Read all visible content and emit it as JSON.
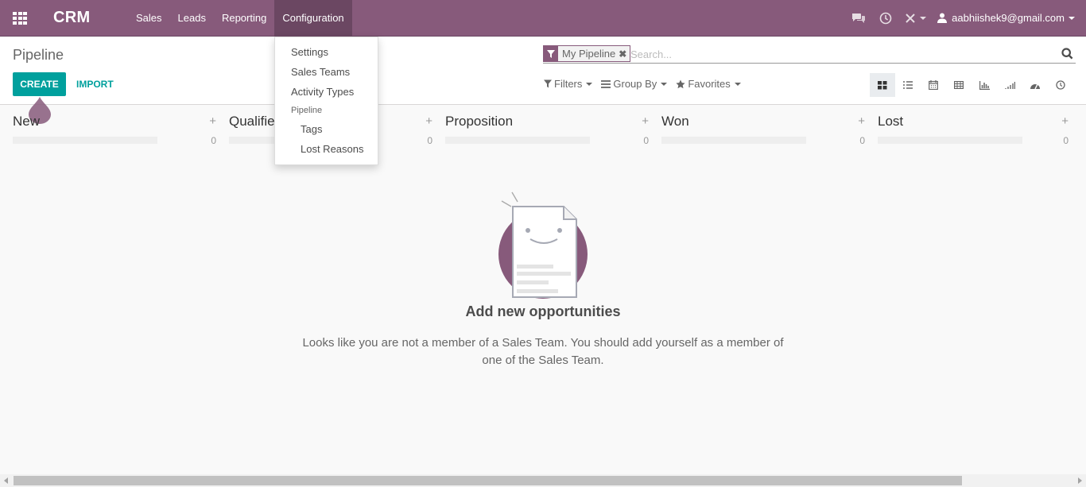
{
  "topbar": {
    "brand": "CRM",
    "menu": [
      "Sales",
      "Leads",
      "Reporting",
      "Configuration"
    ],
    "active_menu": "Configuration",
    "user": "aabhiishek9@gmail.com",
    "icons": [
      "apps-grid-icon",
      "chat-icon",
      "clock-icon",
      "debug-tools-icon",
      "user-icon"
    ]
  },
  "control_panel": {
    "breadcrumb": "Pipeline",
    "create_label": "CREATE",
    "import_label": "IMPORT",
    "search": {
      "facet": "My Pipeline",
      "placeholder": "Search..."
    },
    "filters_label": "Filters",
    "group_by_label": "Group By",
    "favorites_label": "Favorites",
    "views": [
      "kanban",
      "list",
      "calendar",
      "pivot",
      "graph",
      "cohort",
      "dashboard",
      "activity"
    ],
    "active_view": "kanban"
  },
  "kanban": {
    "columns": [
      {
        "title": "New",
        "count": "0"
      },
      {
        "title": "Qualified",
        "count": "0"
      },
      {
        "title": "Proposition",
        "count": "0"
      },
      {
        "title": "Won",
        "count": "0"
      },
      {
        "title": "Lost",
        "count": "0"
      }
    ]
  },
  "dropdown": {
    "items": [
      {
        "label": "Settings",
        "kind": "item"
      },
      {
        "label": "Sales Teams",
        "kind": "item"
      },
      {
        "label": "Activity Types",
        "kind": "item"
      },
      {
        "label": "Pipeline",
        "kind": "header"
      },
      {
        "label": "Tags",
        "kind": "sub"
      },
      {
        "label": "Lost Reasons",
        "kind": "sub"
      }
    ]
  },
  "empty_state": {
    "title": "Add new opportunities",
    "text": "Looks like you are not a member of a Sales Team. You should add yourself as a member of one of the Sales Team."
  },
  "colors": {
    "brand": "#875a7b",
    "accent": "#00a09d"
  }
}
